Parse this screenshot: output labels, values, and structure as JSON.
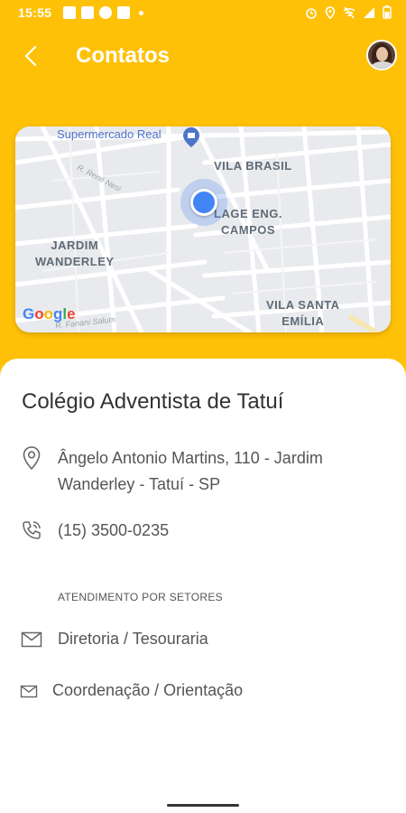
{
  "status_bar": {
    "time": "15:55"
  },
  "app_bar": {
    "title": "Contatos",
    "back_icon": "chevron-left-icon",
    "avatar_icon": "user-avatar"
  },
  "map": {
    "poi": "Supermercado Real",
    "labels": {
      "vila_brasil": "VILA BRASIL",
      "village_line1": "LAGE ENG.",
      "village_line2": "CAMPOS",
      "jardim_line1": "JARDIM",
      "jardim_line2": "WANDERLEY",
      "vila_santa_line1": "VILA SANTA",
      "vila_santa_line2": "EMÍLIA"
    },
    "streets": {
      "rene": "R. René Nesi",
      "fanani": "R. Fanani Salum"
    },
    "google_logo": "Google"
  },
  "contact": {
    "name": "Colégio Adventista de Tatuí",
    "address": "Ângelo Antonio Martins, 110 - Jardim Wanderley - Tatuí - SP",
    "phone": "(15) 3500-0235",
    "section_title": "ATENDIMENTO POR SETORES",
    "departments": [
      {
        "label": "Diretoria / Tesouraria",
        "icon": "mail-icon"
      },
      {
        "label": "Coordenação / Orientação",
        "icon": "mail-icon"
      }
    ]
  },
  "colors": {
    "accent": "#FFC107",
    "location_blue": "#4285F4"
  }
}
